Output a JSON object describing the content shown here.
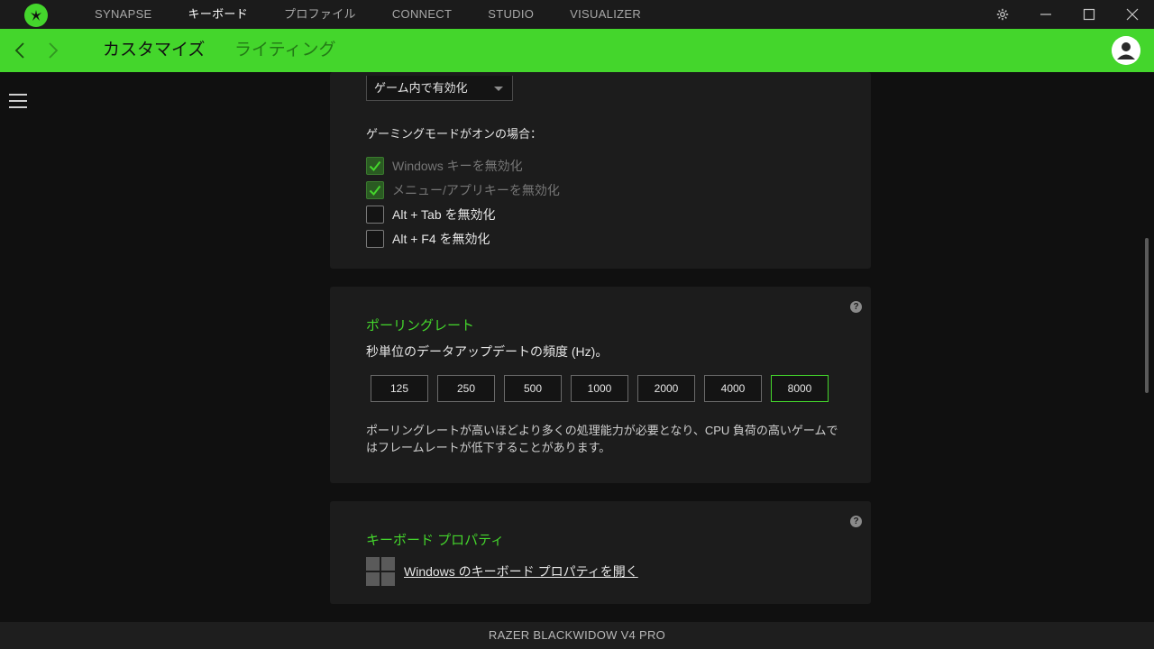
{
  "titlebar": {
    "nav": [
      "SYNAPSE",
      "キーボード",
      "プロファイル",
      "CONNECT",
      "STUDIO",
      "VISUALIZER"
    ],
    "active_index": 1
  },
  "subheader": {
    "tabs": [
      "カスタマイズ",
      "ライティング"
    ],
    "active_index": 0
  },
  "gaming_mode": {
    "dropdown_value": "ゲーム内で有効化",
    "heading": "ゲーミングモードがオンの場合：",
    "options": [
      {
        "label": "Windows キーを無効化",
        "checked": true,
        "disabled": true
      },
      {
        "label": "メニュー/アプリキーを無効化",
        "checked": true,
        "disabled": true
      },
      {
        "label": "Alt + Tab を無効化",
        "checked": false,
        "disabled": false
      },
      {
        "label": "Alt + F4 を無効化",
        "checked": false,
        "disabled": false
      }
    ]
  },
  "polling": {
    "title": "ポーリングレート",
    "description": "秒単位のデータアップデートの頻度 (Hz)。",
    "rates": [
      "125",
      "250",
      "500",
      "1000",
      "2000",
      "4000",
      "8000"
    ],
    "selected": "8000",
    "note": "ポーリングレートが高いほどより多くの処理能力が必要となり、CPU 負荷の高いゲームではフレームレートが低下することがあります。",
    "help_icon": "?"
  },
  "keyboard_props": {
    "title": "キーボード プロパティ",
    "link": "Windows のキーボード プロパティを開く",
    "help_icon": "?"
  },
  "footer": {
    "device": "RAZER BLACKWIDOW V4 PRO"
  },
  "colors": {
    "accent": "#44d62c",
    "background": "#101010",
    "card": "#1c1c1c"
  }
}
